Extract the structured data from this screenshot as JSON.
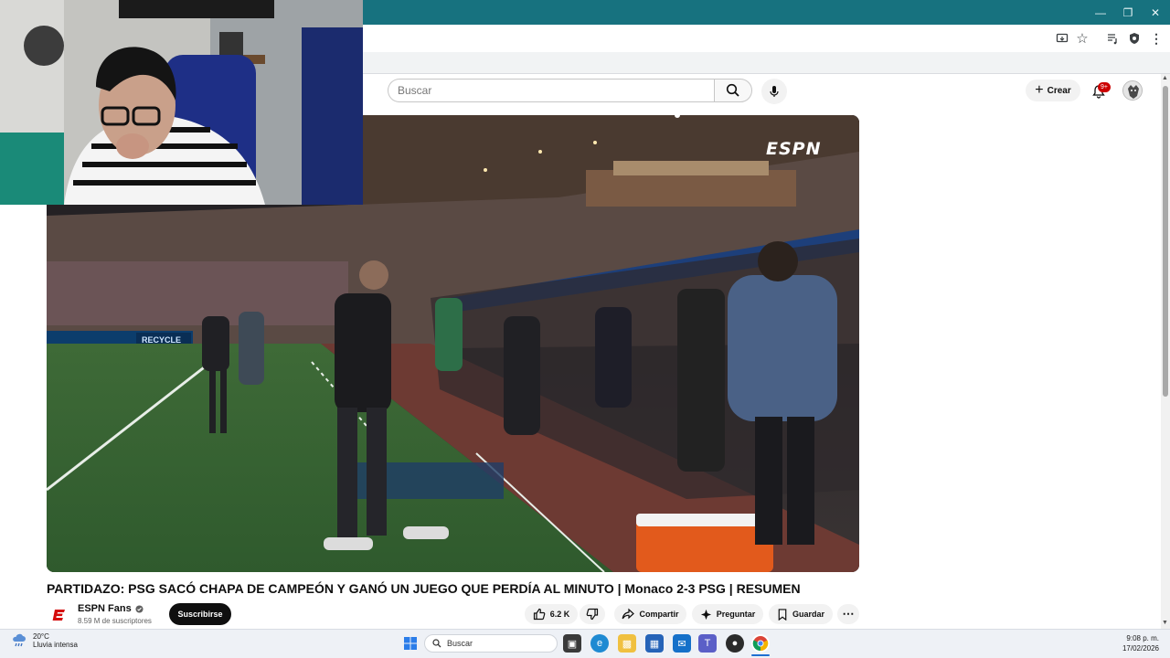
{
  "youtube": {
    "search": {
      "placeholder": "Buscar"
    },
    "create_label": "Crear",
    "notifications_badge": "9+"
  },
  "video": {
    "title": "PARTIDAZO: PSG SACÓ CHAPA DE CAMPEÓN Y GANÓ UN JUEGO QUE PERDÍA AL MINUTO | Monaco 2-3 PSG | RESUMEN",
    "overlay_logo": "ESPN",
    "ad_boards": [
      "RECYCLE"
    ]
  },
  "channel": {
    "name": "ESPN Fans",
    "subscribers": "8.59 M de suscriptores",
    "subscribe_label": "Suscribirse",
    "logo_letter": "E"
  },
  "actions": {
    "likes": "6.2 K",
    "share_label": "Compartir",
    "ask_label": "Preguntar",
    "save_label": "Guardar"
  },
  "taskbar": {
    "weather_temp": "20°C",
    "weather_desc": "Lluvia intensa",
    "search_label": "Buscar",
    "time": "9:08 p. m.",
    "date": "17/02/2026"
  },
  "colors": {
    "titlebar": "#17727f",
    "subscribe_bg": "#0f0f0f",
    "badge": "#cc0000",
    "espn_red": "#d50a0a"
  }
}
